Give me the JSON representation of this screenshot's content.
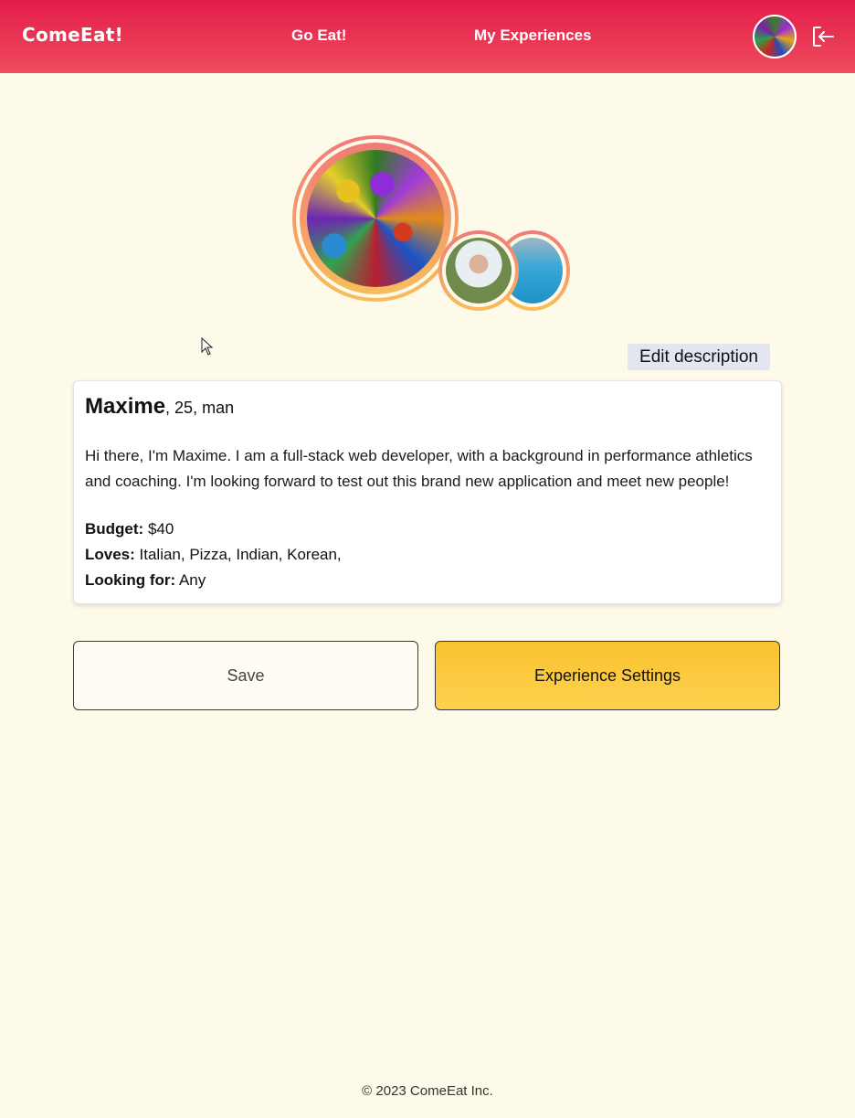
{
  "header": {
    "brand": "ComeEat!",
    "nav": [
      {
        "label": "Go Eat!"
      },
      {
        "label": "My Experiences"
      }
    ]
  },
  "profile": {
    "edit_label": "Edit description",
    "name": "Maxime",
    "age_gender": ", 25, man",
    "bio": "Hi there, I'm Maxime. I am a full-stack web developer, with a background in performance athletics and coaching. I'm looking forward to test out this brand new application and meet new people!",
    "budget_label": "Budget:",
    "budget_value": " $40",
    "loves_label": "Loves:",
    "loves_value": " Italian, Pizza, Indian, Korean,",
    "looking_label": "Looking for:",
    "looking_value": " Any"
  },
  "actions": {
    "save_label": "Save",
    "experience_label": "Experience Settings"
  },
  "footer": {
    "copyright": "© 2023 ComeEat Inc."
  },
  "colors": {
    "header_red": "#e31c4a",
    "background": "#fefae9",
    "accent_yellow": "#fbc22f",
    "ring_gradient_top": "#f07a78",
    "ring_gradient_bottom": "#f8bd5b"
  }
}
